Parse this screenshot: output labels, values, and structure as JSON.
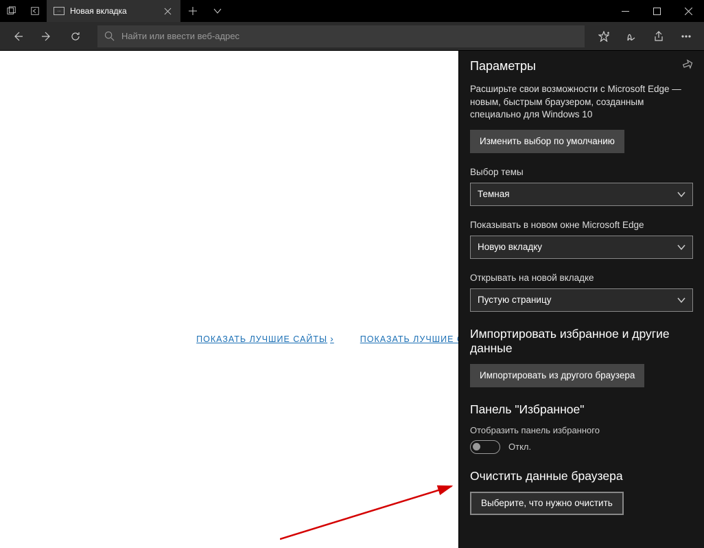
{
  "titlebar": {
    "tab_title": "Новая вкладка"
  },
  "toolbar": {
    "search_placeholder": "Найти или ввести веб-адрес"
  },
  "page": {
    "link1": "ПОКАЗАТЬ ЛУЧШИЕ САЙТЫ",
    "link2": "ПОКАЗАТЬ ЛУЧШИЕ САЙТЫ И"
  },
  "panel": {
    "title": "Параметры",
    "promo_text": "Расширьте свои возможности с Microsoft Edge — новым, быстрым браузером, созданным специально для Windows 10",
    "change_default_btn": "Изменить выбор по умолчанию",
    "theme_label": "Выбор темы",
    "theme_value": "Темная",
    "open_with_label": "Показывать в новом окне Microsoft Edge",
    "open_with_value": "Новую вкладку",
    "newtab_label": "Открывать на новой вкладке",
    "newtab_value": "Пустую страницу",
    "import_title": "Импортировать избранное и другие данные",
    "import_btn": "Импортировать из другого браузера",
    "fav_title": "Панель \"Избранное\"",
    "fav_sublabel": "Отобразить панель избранного",
    "fav_toggle_state": "Откл.",
    "clear_title": "Очистить данные браузера",
    "clear_btn": "Выберите, что нужно очистить"
  }
}
